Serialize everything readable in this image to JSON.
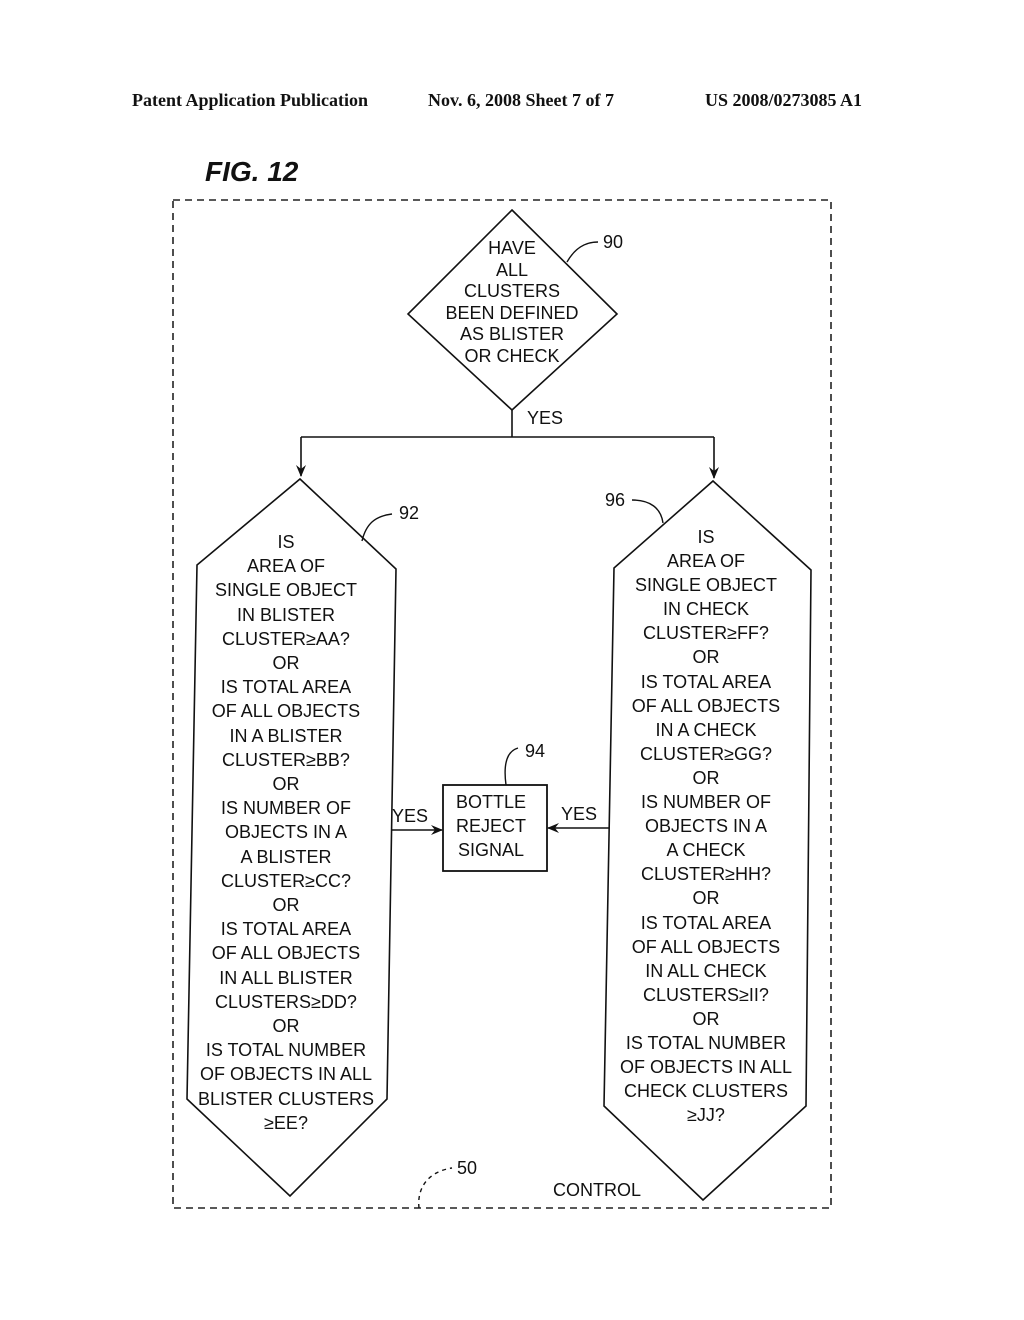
{
  "header": {
    "publication": "Patent Application Publication",
    "date_sheet": "Nov. 6, 2008   Sheet 7 of 7",
    "number": "US 2008/0273085 A1"
  },
  "figure_title": "FIG. 12",
  "nodes": {
    "n90": {
      "ref": "90",
      "lines": [
        "HAVE",
        "ALL",
        "CLUSTERS",
        "BEEN DEFINED",
        "AS BLISTER",
        "OR CHECK"
      ]
    },
    "n92": {
      "ref": "92",
      "lines": [
        "IS",
        "AREA OF",
        "SINGLE OBJECT",
        "IN BLISTER",
        "CLUSTER≥AA?",
        "OR",
        "IS TOTAL AREA",
        "OF ALL OBJECTS",
        "IN A BLISTER",
        "CLUSTER≥BB?",
        "OR",
        "IS NUMBER OF",
        "OBJECTS IN A",
        "A BLISTER",
        "CLUSTER≥CC?",
        "OR",
        "IS TOTAL AREA",
        "OF ALL OBJECTS",
        "IN ALL BLISTER",
        "CLUSTERS≥DD?",
        "OR",
        "IS TOTAL NUMBER",
        "OF OBJECTS IN ALL",
        "BLISTER CLUSTERS",
        "≥EE?"
      ]
    },
    "n94": {
      "ref": "94",
      "lines": [
        "BOTTLE",
        "REJECT",
        "SIGNAL"
      ]
    },
    "n96": {
      "ref": "96",
      "lines": [
        "IS",
        "AREA OF",
        "SINGLE OBJECT",
        "IN CHECK",
        "CLUSTER≥FF?",
        "OR",
        "IS TOTAL AREA",
        "OF ALL OBJECTS",
        "IN A CHECK",
        "CLUSTER≥GG?",
        "OR",
        "IS NUMBER OF",
        "OBJECTS IN A",
        "A CHECK",
        "CLUSTER≥HH?",
        "OR",
        "IS TOTAL AREA",
        "OF ALL OBJECTS",
        "IN ALL CHECK",
        "CLUSTERS≥II?",
        "OR",
        "IS TOTAL NUMBER",
        "OF OBJECTS IN ALL",
        "CHECK CLUSTERS",
        "≥JJ?"
      ]
    }
  },
  "edges": {
    "yes_top": "YES",
    "yes_left": "YES",
    "yes_right": "YES"
  },
  "container": {
    "ref": "50",
    "label": "CONTROL"
  }
}
